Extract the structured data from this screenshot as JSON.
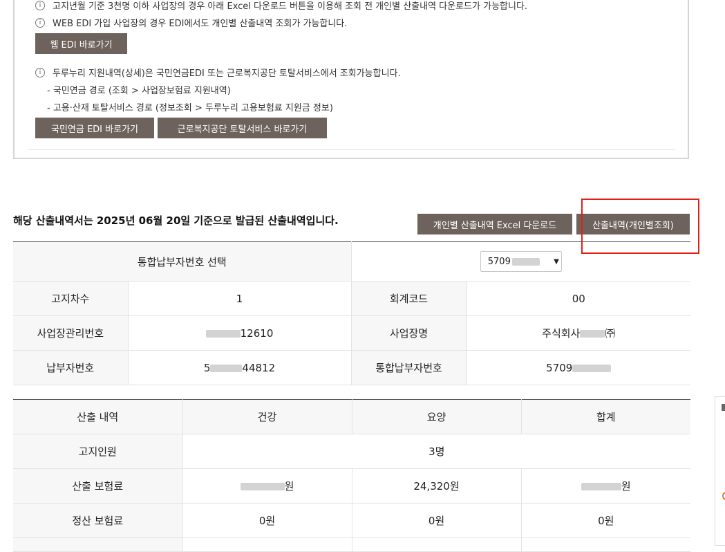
{
  "notices": {
    "line1": "고지년월 기준 3천명 이하 사업장의 경우 아래 Excel 다운로드 버튼을 이용해 조회 전 개인별 산출내역 다운로드가 가능합니다.",
    "line2": "WEB EDI 가입 사업장의 경우 EDI에서도 개인별 산출내역 조회가 가능합니다.",
    "web_edi_button": "웹 EDI 바로가기",
    "line3": "두루누리 지원내역(상세)은 국민연금EDI 또는 근로복지공단 토탈서비스에서 조회가능합니다.",
    "sub1": "- 국민연금 경로 (조회 > 사업장보험료 지원내역)",
    "sub2": "- 고용·산재 토탈서비스 경로 (정보조회 > 두루누리 고용보험료 지원금 정보)",
    "pension_edi_button": "국민연금 EDI 바로가기",
    "comwel_button": "근로복지공단 토탈서비스 바로가기"
  },
  "issue_statement": "해당 산출내역서는 2025년 06월 20일 기준으로 발급된 산출내역입니다.",
  "actions": {
    "excel_download": "개인별 산출내역 Excel 다운로드",
    "individual_view": "산출내역(개인별조회)"
  },
  "info_table": {
    "select_label": "통합납부자번호 선택",
    "select_value": "5709",
    "rows": [
      {
        "label1": "고지차수",
        "value1": "1",
        "label2": "회계코드",
        "value2": "00"
      },
      {
        "label1": "사업장관리번호",
        "value1_prefix": "",
        "value1": "12610",
        "label2": "사업장명",
        "value2": "주식회사",
        "value2_suffix": "",
        "value2_tail": "㈜"
      },
      {
        "label1": "납부자번호",
        "value1_prefix": "5",
        "value1": "44812",
        "label2": "통합납부자번호",
        "value2": "5709"
      }
    ]
  },
  "calc_table": {
    "headers": [
      "산출 내역",
      "건강",
      "요양",
      "합계"
    ],
    "rows": [
      {
        "label": "고지인원",
        "merged": "3명"
      },
      {
        "label": "산출 보험료",
        "health_prefix": "",
        "health": "원",
        "care": "24,320원",
        "total": "원"
      },
      {
        "label": "정산 보험료",
        "health": "0원",
        "care": "0원",
        "total": "0원"
      }
    ]
  },
  "colors": {
    "button_bg": "#6e625c",
    "highlight_box": "#e0201a"
  }
}
